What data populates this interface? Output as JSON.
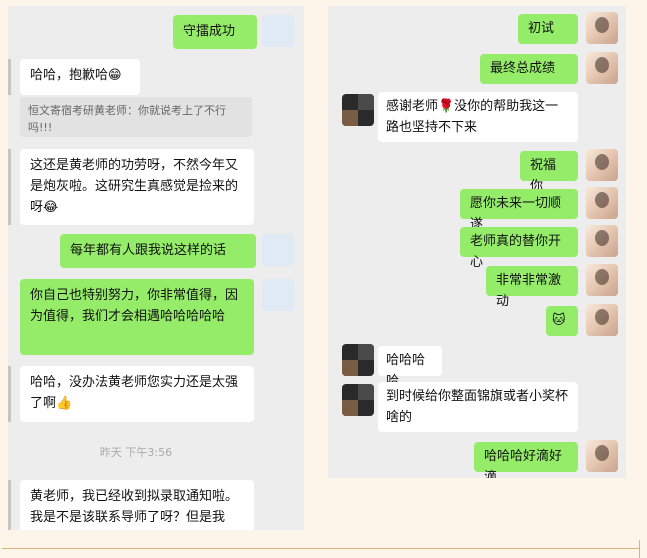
{
  "left": {
    "msg1": "守擂成功",
    "msg2": "哈哈，抱歉哈😁",
    "quote": "恒文寄宿考研黄老师：你就说考上了不行吗!!!",
    "msg3": "这还是黄老师的功劳呀，不然今年又是炮灰啦。这研究生真感觉是捡来的呀😂",
    "msg4": "每年都有人跟我说这样的话",
    "msg5": "你自己也特别努力，你非常值得，因为值得，我们才会相遇哈哈哈哈哈",
    "msg6": "哈哈，没办法黄老师您实力还是太强了啊👍",
    "timestamp": "昨天 下午3:56",
    "msg7": "黄老师，我已经收到拟录取通知啦。我是不是该联系导师了呀？但是我"
  },
  "right": {
    "msg1": "初试",
    "msg2": "最终总成绩",
    "msg3": "感谢老师🌹没你的帮助我这一路也坚持不下来",
    "msg4": "祝福你",
    "msg5": "愿你未来一切顺遂",
    "msg6": "老师真的替你开心",
    "msg7": "非常非常激动",
    "msg8": "🐱",
    "msg9": "哈哈哈哈",
    "msg10": "到时候给你整面锦旗或者小奖杯啥的",
    "msg11": "哈哈哈好滴好滴"
  }
}
